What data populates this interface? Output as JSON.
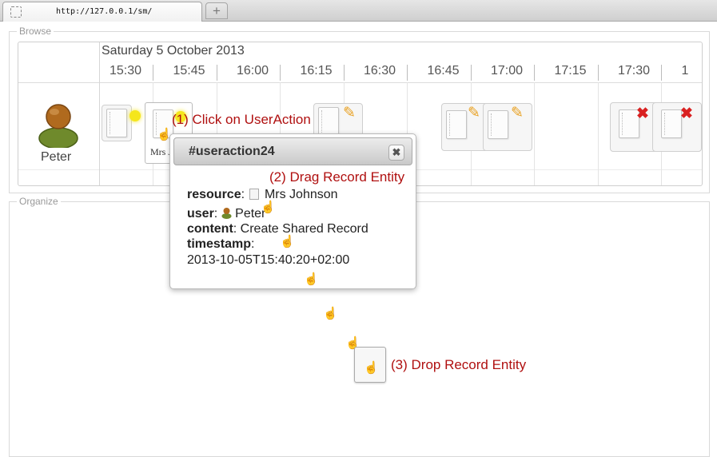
{
  "browser": {
    "tab_url": "http://127.0.0.1/sm/",
    "new_tab_symbol": "+"
  },
  "browse": {
    "legend": "Browse",
    "date": "Saturday 5 October 2013",
    "times": [
      "15:30",
      "15:45",
      "16:00",
      "16:15",
      "16:30",
      "16:45",
      "17:00",
      "17:15",
      "17:30",
      "1"
    ],
    "user_name": "Peter",
    "mrs_label": "Mrs J",
    "entities": [
      "plain",
      "plain",
      "edit",
      "edit",
      "edit",
      "delete",
      "delete"
    ]
  },
  "organize": {
    "legend": "Organize"
  },
  "popup": {
    "title": "#useraction24",
    "close_symbol": "✖",
    "resource_key": "resource",
    "resource_value": "Mrs Johnson",
    "user_key": "user",
    "user_value": "Peter",
    "content_key": "content",
    "content_value": "Create Shared Record",
    "timestamp_key": "timestamp",
    "timestamp_value": "2013-10-05T15:40:20+02:00"
  },
  "annotations": {
    "step1": "(1) Click on UserAction",
    "step2": "(2) Drag Record Entity",
    "step3": "(3) Drop Record Entity"
  },
  "colors": {
    "annotation": "#b01010",
    "avatar_head": "#b06a1e",
    "avatar_body": "#6f8a2c",
    "highlight": "#f5e61c",
    "delete_mark": "#d92020",
    "pencil": "#e8a020"
  }
}
